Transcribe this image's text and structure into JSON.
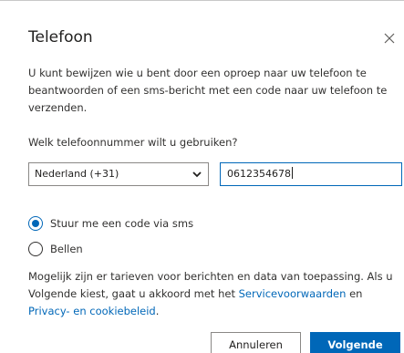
{
  "dialog": {
    "title": "Telefoon",
    "description": "U kunt bewijzen wie u bent door een oproep naar uw telefoon te beantwoorden of een sms-bericht met een code naar uw telefoon te verzenden.",
    "question": "Welk telefoonnummer wilt u gebruiken?",
    "country_select": {
      "selected": "Nederland (+31)"
    },
    "phone_input": {
      "value": "0612354678"
    },
    "options": [
      {
        "label": "Stuur me een code via sms",
        "checked": true
      },
      {
        "label": "Bellen",
        "checked": false
      }
    ],
    "legal": {
      "text_before": "Mogelijk zijn er tarieven voor berichten en data van toepassing. Als u Volgende kiest, gaat u akkoord met het ",
      "terms_link": "Servicevoorwaarden",
      "text_middle": " en ",
      "privacy_link": "Privacy- en cookiebeleid",
      "text_after": "."
    },
    "buttons": {
      "cancel": "Annuleren",
      "next": "Volgende"
    }
  },
  "colors": {
    "accent": "#0067b8",
    "text": "#323130",
    "border": "#8a8886"
  },
  "icons": {
    "close": "close-icon",
    "dropdown": "chevron-down-icon"
  }
}
